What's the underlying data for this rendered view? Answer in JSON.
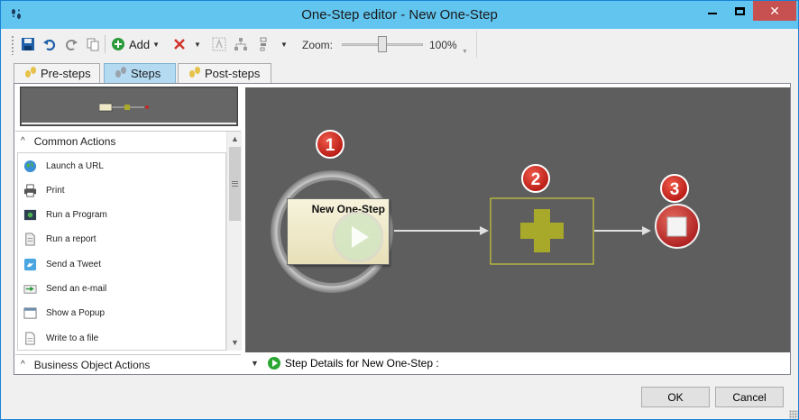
{
  "window": {
    "title": "One-Step editor - New One-Step",
    "app_icon": "footprints-icon",
    "close_glyph": "✕"
  },
  "toolbar": {
    "add_label": "Add",
    "zoom_label": "Zoom:",
    "zoom_value": "100%",
    "zoom_level_percent": 100,
    "icons": [
      "save-icon",
      "undo-icon",
      "redo-icon",
      "copy-icon",
      "add-icon",
      "delete-icon",
      "text-icon",
      "hierarchy-icon",
      "align-icon"
    ]
  },
  "tabs": [
    {
      "label": "Pre-steps",
      "active": false
    },
    {
      "label": "Steps",
      "active": true
    },
    {
      "label": "Post-steps",
      "active": false
    }
  ],
  "sidebar": {
    "sections": [
      {
        "label": "Common Actions",
        "expanded": true
      },
      {
        "label": "Business Object Actions",
        "expanded": true
      }
    ],
    "items": [
      {
        "label": "Launch a URL",
        "icon": "globe-icon"
      },
      {
        "label": "Print",
        "icon": "printer-icon"
      },
      {
        "label": "Run a Program",
        "icon": "program-icon"
      },
      {
        "label": "Run a report",
        "icon": "report-icon"
      },
      {
        "label": "Send a Tweet",
        "icon": "twitter-icon"
      },
      {
        "label": "Send an e-mail",
        "icon": "email-icon"
      },
      {
        "label": "Show a Popup",
        "icon": "popup-icon"
      },
      {
        "label": "Write to a file",
        "icon": "file-icon"
      }
    ]
  },
  "flow": {
    "start_card_title": "New One-Step",
    "badges": [
      "1",
      "2",
      "3"
    ],
    "colors": {
      "canvas": "#5e5e5e",
      "badge_red": "#c8201f",
      "add_olive": "#a8a82a",
      "stop_red": "#c0282a"
    }
  },
  "details": {
    "label": "Step Details for New One-Step :"
  },
  "footer": {
    "ok_label": "OK",
    "cancel_label": "Cancel"
  }
}
